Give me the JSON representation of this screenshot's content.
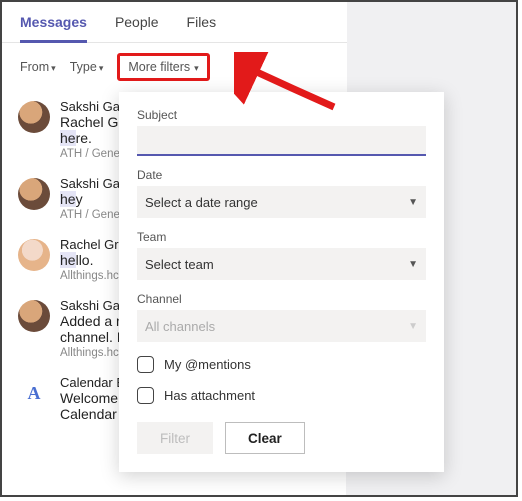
{
  "tabs": {
    "messages": "Messages",
    "people": "People",
    "files": "Files"
  },
  "filterbar": {
    "from": "From",
    "type": "Type",
    "more": "More filters"
  },
  "messages": [
    {
      "name": "Sakshi Garg",
      "pre": "Rachel Gre",
      "hl": "he",
      "post": "re.",
      "loc": "ATH / Gene"
    },
    {
      "name": "Sakshi Garg",
      "pre": "",
      "hl": "he",
      "post": "y",
      "loc": "ATH / Gene"
    },
    {
      "name": "Rachel Gree",
      "pre": "",
      "hl": "he",
      "post": "llo.",
      "loc": "Allthings.hc"
    },
    {
      "name": "Sakshi Garg",
      "pre": "Added a n",
      "hl": "",
      "post": "channel. H",
      "loc": "Allthings.hc"
    },
    {
      "name": "Calendar BO",
      "pre": "Welcome",
      "hl": "",
      "post": "Calendar Bot. I can help you view",
      "loc": ""
    }
  ],
  "panel": {
    "lbl_subject": "Subject",
    "subject_val": "",
    "lbl_date": "Date",
    "date_sel": "Select a date range",
    "lbl_team": "Team",
    "team_sel": "Select team",
    "lbl_channel": "Channel",
    "channel_sel": "All channels",
    "chk_mentions": "My @mentions",
    "chk_attach": "Has attachment",
    "btn_filter": "Filter",
    "btn_clear": "Clear"
  },
  "icons": {
    "calendar_glyph": "A"
  }
}
